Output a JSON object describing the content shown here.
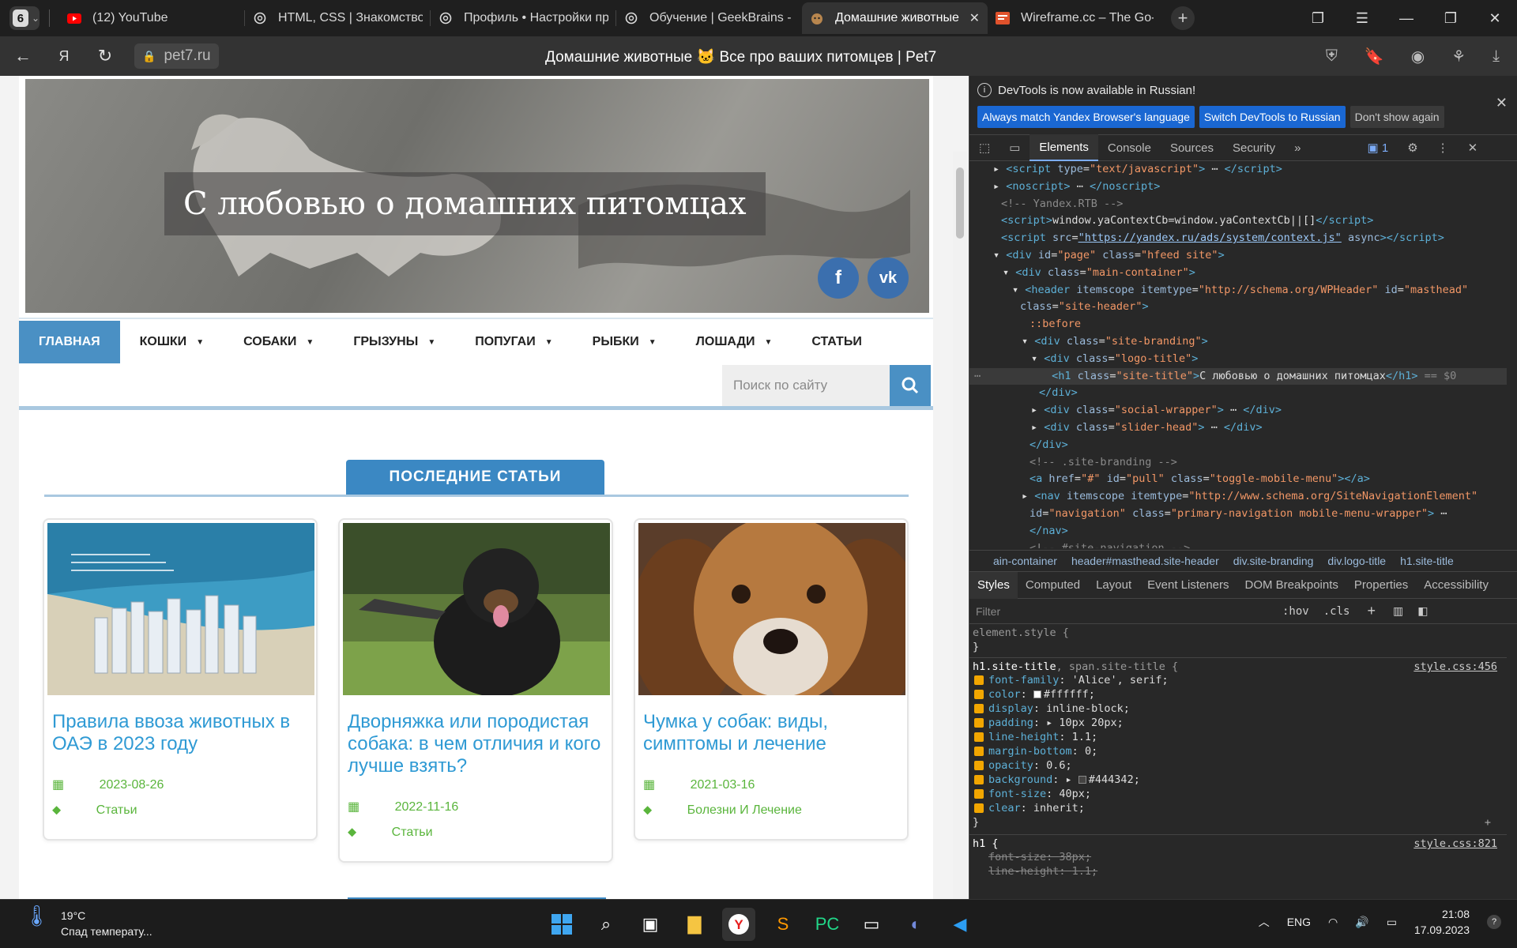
{
  "browser": {
    "tab_count": "6",
    "tabs": [
      {
        "title": "(12) YouTube",
        "icon": "youtube-icon"
      },
      {
        "title": "HTML, CSS | Знакомство",
        "icon": "openai-icon"
      },
      {
        "title": "Профиль • Настройки пр",
        "icon": "openai-icon"
      },
      {
        "title": "Обучение | GeekBrains -",
        "icon": "openai-icon"
      },
      {
        "title": "Домашние животные",
        "icon": "pet-icon",
        "active": true
      },
      {
        "title": "Wireframe.cc – The Go-to",
        "icon": "wireframe-icon"
      }
    ],
    "url": "pet7.ru",
    "page_title": "Домашние животные 🐱 Все про ваших питомцев | Pet7",
    "notif_badge": "1"
  },
  "site": {
    "hero_title": "С любовью о домашних питомцах",
    "social": {
      "fb": "f",
      "vk": "vk"
    },
    "nav": [
      {
        "label": "Главная",
        "active": true,
        "dropdown": false
      },
      {
        "label": "Кошки",
        "dropdown": true
      },
      {
        "label": "Собаки",
        "dropdown": true
      },
      {
        "label": "Грызуны",
        "dropdown": true
      },
      {
        "label": "Попугаи",
        "dropdown": true
      },
      {
        "label": "Рыбки",
        "dropdown": true
      },
      {
        "label": "Лошади",
        "dropdown": true
      },
      {
        "label": "Статьи",
        "dropdown": false
      }
    ],
    "search_placeholder": "Поиск по сайту",
    "section_title": "ПОСЛЕДНИЕ СТАТЬИ",
    "cards": [
      {
        "title": "Правила ввоза животных в ОАЭ в 2023 году",
        "date": "2023-08-26",
        "category": "Статьи"
      },
      {
        "title": "Дворняжка или породистая собака: в чем отличия и кого лучше взять?",
        "date": "2022-11-16",
        "category": "Статьи"
      },
      {
        "title": "Чумка у собак: виды, симптомы и лечение",
        "date": "2021-03-16",
        "category": "Болезни И Лечение"
      }
    ]
  },
  "devtools": {
    "info": "DevTools is now available in Russian!",
    "btn_match": "Always match Yandex Browser's language",
    "btn_switch": "Switch DevTools to Russian",
    "btn_dont": "Don't show again",
    "tabs": [
      "Elements",
      "Console",
      "Sources",
      "Security"
    ],
    "issues": "1",
    "crumbs": [
      "ain-container",
      "header#masthead.site-header",
      "div.site-branding",
      "div.logo-title",
      "h1.site-title"
    ],
    "style_tabs": [
      "Styles",
      "Computed",
      "Layout",
      "Event Listeners",
      "DOM Breakpoints",
      "Properties",
      "Accessibility"
    ],
    "filter": "Filter",
    "hov": ":hov",
    "cls": ".cls",
    "element_style": "element.style {",
    "close_brace": "}",
    "rule_selector": "h1.site-title",
    "rule_selector2": ", span.site-title {",
    "rule_src": "style.css:456",
    "props": [
      {
        "n": "font-family",
        "v": "'Alice', serif;"
      },
      {
        "n": "color",
        "v": "#ffffff;"
      },
      {
        "n": "display",
        "v": "inline-block;"
      },
      {
        "n": "padding",
        "v": "10px 20px;"
      },
      {
        "n": "line-height",
        "v": "1.1;"
      },
      {
        "n": "margin-bottom",
        "v": "0;"
      },
      {
        "n": "opacity",
        "v": "0.6;"
      },
      {
        "n": "background",
        "v": "#444342;"
      },
      {
        "n": "font-size",
        "v": "40px;"
      },
      {
        "n": "clear",
        "v": "inherit;"
      }
    ],
    "h1_selector": "h1 {",
    "h1_src": "style.css:821",
    "h1_props": [
      {
        "n": "font-size",
        "v": "38px;"
      },
      {
        "n": "line-height",
        "v": "1.1;"
      }
    ]
  },
  "taskbar": {
    "temp": "19°C",
    "weather": "Спад температу...",
    "lang": "ENG",
    "time": "21:08",
    "date": "17.09.2023"
  }
}
